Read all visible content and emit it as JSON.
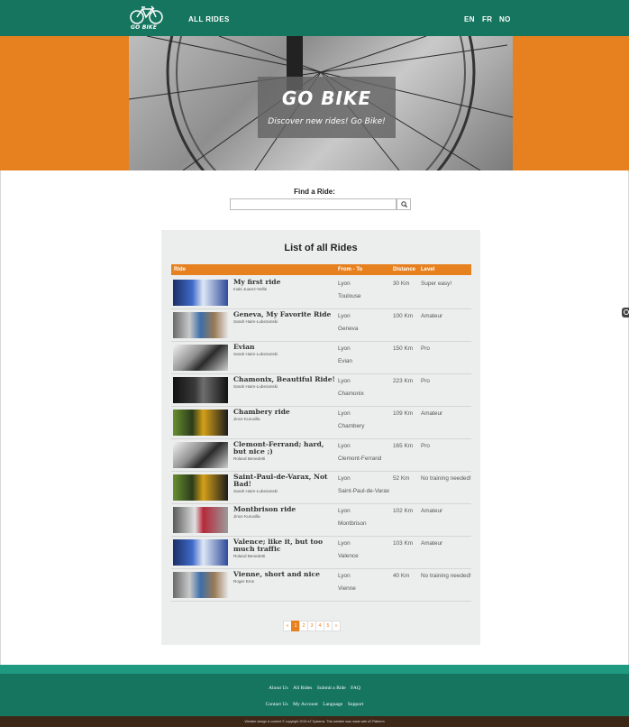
{
  "header": {
    "logo_text": "GO BIKE",
    "nav_all_rides": "ALL RIDES",
    "languages": [
      "EN",
      "FR",
      "NO"
    ]
  },
  "hero": {
    "title": "GO BIKE",
    "subtitle": "Discover new rides! Go Bike!"
  },
  "search": {
    "label": "Find a Ride:",
    "placeholder": "",
    "button_icon": "search-icon"
  },
  "list": {
    "title": "List of all Rides",
    "columns": [
      "Ride",
      "From - To",
      "Distance",
      "Level"
    ],
    "rides": [
      {
        "title": "My first ride",
        "author": "Inaki Juarez-Vellis",
        "from": "Lyon",
        "to": "Toulouse",
        "distance": "30 Km",
        "level": "Super easy!"
      },
      {
        "title": "Geneva, My Favorite Ride",
        "author": "Sarah Haim-Lubezanski",
        "from": "Lyon",
        "to": "Geneva",
        "distance": "100 Km",
        "level": "Amateur"
      },
      {
        "title": "Evian",
        "author": "Sarah Haim-Lubezanski",
        "from": "Lyon",
        "to": "Evian",
        "distance": "150 Km",
        "level": "Pro"
      },
      {
        "title": "Chamonix, Beautiful Ride!",
        "author": "Sarah Haim-Lubezanski",
        "from": "Lyon",
        "to": "Chamonix",
        "distance": "223 Km",
        "level": "Pro"
      },
      {
        "title": "Chambery ride",
        "author": "Jince Kuruvilla",
        "from": "Lyon",
        "to": "Chambery",
        "distance": "109 Km",
        "level": "Amateur"
      },
      {
        "title": "Clemont-Ferrand; hard, but nice ;)",
        "author": "Roland Benedetti",
        "from": "Lyon",
        "to": "Clemont-Ferrand",
        "distance": "165 Km",
        "level": "Pro"
      },
      {
        "title": "Saint-Paul-de-Varax, Not Bad!",
        "author": "Sarah Haim-Lubezanski",
        "from": "Lyon",
        "to": "Saint-Paul-de-Varax",
        "distance": "52 Km",
        "level": "No training needed!"
      },
      {
        "title": "Montbrison ride",
        "author": "Jince Kuruvilla",
        "from": "Lyon",
        "to": "Montbrison",
        "distance": "102 Km",
        "level": "Amateur"
      },
      {
        "title": "Valence; like it, but too much traffic",
        "author": "Roland Benedetti",
        "from": "Lyon",
        "to": "Valence",
        "distance": "103 Km",
        "level": "Amateur"
      },
      {
        "title": "Vienne, short and nice",
        "author": "Roger Ems",
        "from": "Lyon",
        "to": "Vienne",
        "distance": "40 Km",
        "level": "No training needed!"
      }
    ]
  },
  "pagination": {
    "prev": "«",
    "pages": [
      "1",
      "2",
      "3",
      "4",
      "5"
    ],
    "next": "»",
    "active_page": "1"
  },
  "footer": {
    "links_row1": [
      "About Us",
      "All Rides",
      "Submit a Ride",
      "FAQ"
    ],
    "links_row2": [
      "Contact Us",
      "My Account",
      "Language",
      "Support"
    ],
    "copyright": "Website design & content © copyright 2015 eZ Systems. This website was made with eZ Platform"
  },
  "colors": {
    "brand_green": "#16755f",
    "brand_orange": "#e7801f",
    "footer_brown": "#3d2717"
  }
}
